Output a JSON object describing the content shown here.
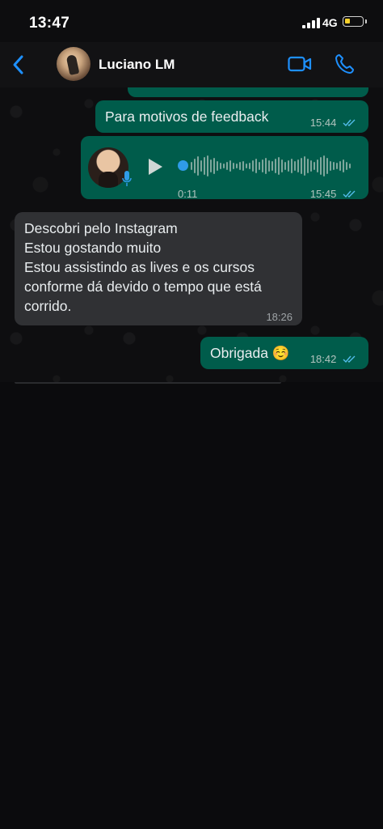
{
  "status_bar": {
    "time": "13:47",
    "network": "4G",
    "battery_level": 0.2,
    "battery_color": "#f7d02a"
  },
  "header": {
    "back_icon": "chevron-left-icon",
    "contact_name": "Luciano LM",
    "video_icon": "video-camera-icon",
    "phone_icon": "phone-icon",
    "accent_color": "#1e90ff"
  },
  "messages": [
    {
      "direction": "out",
      "text": "",
      "time": "15:44",
      "read": true,
      "partial": true
    },
    {
      "direction": "out",
      "text": "Para motivos de feedback",
      "time": "15:44",
      "read": true
    },
    {
      "direction": "out",
      "type": "voice",
      "duration": "0:11",
      "time": "15:45",
      "read": true
    },
    {
      "direction": "in",
      "lines": [
        "Descobri pelo Instagram",
        "Estou gostando muito",
        "Estou assistindo as lives e os cursos",
        "conforme dá devido o tempo que está",
        "corrido."
      ],
      "time": "18:26"
    },
    {
      "direction": "out",
      "text": "Obrigada ☺️",
      "time": "18:42",
      "read": true
    }
  ],
  "colors": {
    "outgoing_bubble": "#005c4b",
    "incoming_bubble": "#303134",
    "read_ticks": "#53bdeb"
  }
}
